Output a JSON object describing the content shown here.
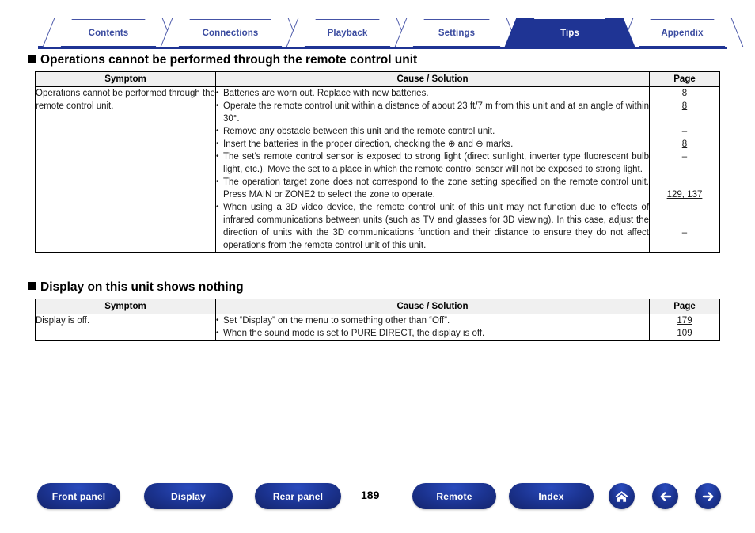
{
  "nav_tabs": [
    {
      "label": "Contents",
      "active": false
    },
    {
      "label": "Connections",
      "active": false
    },
    {
      "label": "Playback",
      "active": false
    },
    {
      "label": "Settings",
      "active": false
    },
    {
      "label": "Tips",
      "active": true
    },
    {
      "label": "Appendix",
      "active": false
    }
  ],
  "sections": [
    {
      "heading": "Operations cannot be performed through the remote control unit",
      "columns": {
        "symptom": "Symptom",
        "cause": "Cause / Solution",
        "page": "Page"
      },
      "rows": [
        {
          "symptom": "Operations cannot be performed through the remote control unit.",
          "causes": [
            {
              "text": "Batteries are worn out. Replace with new batteries.",
              "page": "8",
              "link": true,
              "lines": 1
            },
            {
              "text": "Operate the remote control unit within a distance of about 23 ft/7 m from this unit and at an angle of within 30°.",
              "page": "8",
              "link": true,
              "lines": 2
            },
            {
              "text": "Remove any obstacle between this unit and the remote control unit.",
              "page": "–",
              "link": false,
              "lines": 1
            },
            {
              "text": "Insert the batteries in the proper direction, checking the ⊕ and ⊖ marks.",
              "page": "8",
              "link": true,
              "lines": 1
            },
            {
              "text": "The set’s remote control sensor is exposed to strong light (direct sunlight, inverter type fluorescent bulb light, etc.). Move the set to a place in which the remote control sensor will not be exposed to strong light.",
              "page": "–",
              "link": false,
              "lines": 3
            },
            {
              "text": "The operation target zone does not correspond to the zone setting specified on the remote control unit. Press MAIN or ZONE2 to select the zone to operate.",
              "page": "129, 137",
              "link": true,
              "lines": 2
            },
            {
              "text": "When using a 3D video device, the remote control unit of this unit may not function due to effects of infrared communications between units (such as TV and glasses for 3D viewing). In this case, adjust the direction of units with the 3D communications function and their distance to ensure they do not affect operations from the remote control unit of this unit.",
              "page": "–",
              "link": false,
              "lines": 4
            }
          ]
        }
      ]
    },
    {
      "heading": "Display on this unit shows nothing",
      "columns": {
        "symptom": "Symptom",
        "cause": "Cause / Solution",
        "page": "Page"
      },
      "rows": [
        {
          "symptom": "Display is off.",
          "causes": [
            {
              "text": "Set “Display” on the menu to something other than “Off”.",
              "page": "179",
              "link": true,
              "lines": 1
            },
            {
              "text": "When the sound mode is set to PURE DIRECT, the display is off.",
              "page": "109",
              "link": true,
              "lines": 1
            }
          ]
        }
      ]
    }
  ],
  "page_number": "189",
  "footer": {
    "buttons": [
      {
        "label": "Front panel",
        "icon": ""
      },
      {
        "label": "Display",
        "icon": ""
      },
      {
        "label": "Rear panel",
        "icon": ""
      },
      {
        "label": "Remote",
        "icon": ""
      },
      {
        "label": "Index",
        "icon": ""
      }
    ],
    "icon_buttons": [
      {
        "name": "home-icon"
      },
      {
        "name": "arrow-left-icon"
      },
      {
        "name": "arrow-right-icon"
      }
    ]
  },
  "colors": {
    "brand_blue": "#1f3494",
    "tab_text": "#3b4ca0",
    "header_fill": "#f0f0f0",
    "border": "#000000"
  }
}
